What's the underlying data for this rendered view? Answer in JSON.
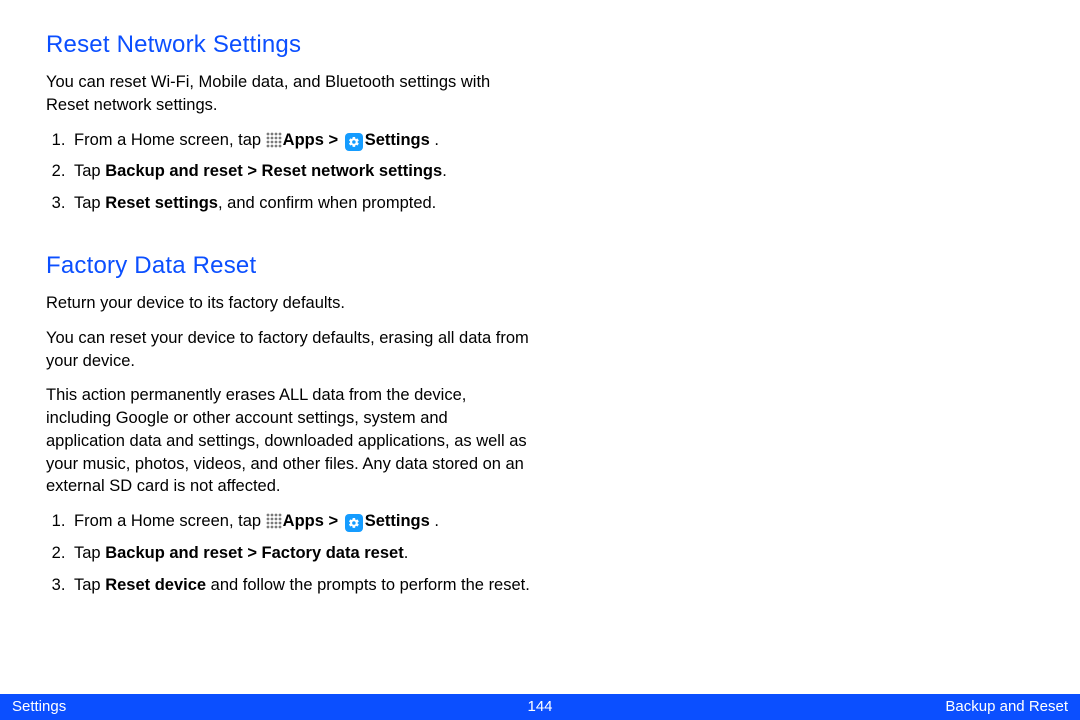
{
  "section1": {
    "heading": "Reset Network Settings",
    "intro": "You can reset Wi-Fi, Mobile data, and Bluetooth settings with Reset network settings.",
    "steps": {
      "s1_prefix": "From a Home screen, tap ",
      "s1_apps": "Apps > ",
      "s1_settings": "Settings",
      "s1_period": " .",
      "s2_prefix": "Tap ",
      "s2_bold": "Backup and reset > Reset network settings",
      "s2_suffix": ".",
      "s3_prefix": "Tap ",
      "s3_bold": "Reset settings",
      "s3_suffix": ", and confirm when prompted."
    }
  },
  "section2": {
    "heading": "Factory Data Reset",
    "p1": "Return your device to its factory defaults.",
    "p2": "You can reset your device to factory defaults, erasing all data from your device.",
    "p3": "This action permanently erases ALL data from the device, including Google or other account settings, system and application data and settings, downloaded applications, as well as your music, photos, videos, and other files. Any data stored on an external SD card is not affected.",
    "steps": {
      "s1_prefix": "From a Home screen, tap ",
      "s1_apps": "Apps > ",
      "s1_settings": "Settings",
      "s1_period": " .",
      "s2_prefix": "Tap ",
      "s2_bold": "Backup and reset > Factory data reset",
      "s2_suffix": ".",
      "s3_prefix": "Tap ",
      "s3_bold": "Reset device",
      "s3_suffix": " and follow the prompts to perform the reset."
    }
  },
  "footer": {
    "left": "Settings",
    "center": "144",
    "right": "Backup and Reset"
  }
}
